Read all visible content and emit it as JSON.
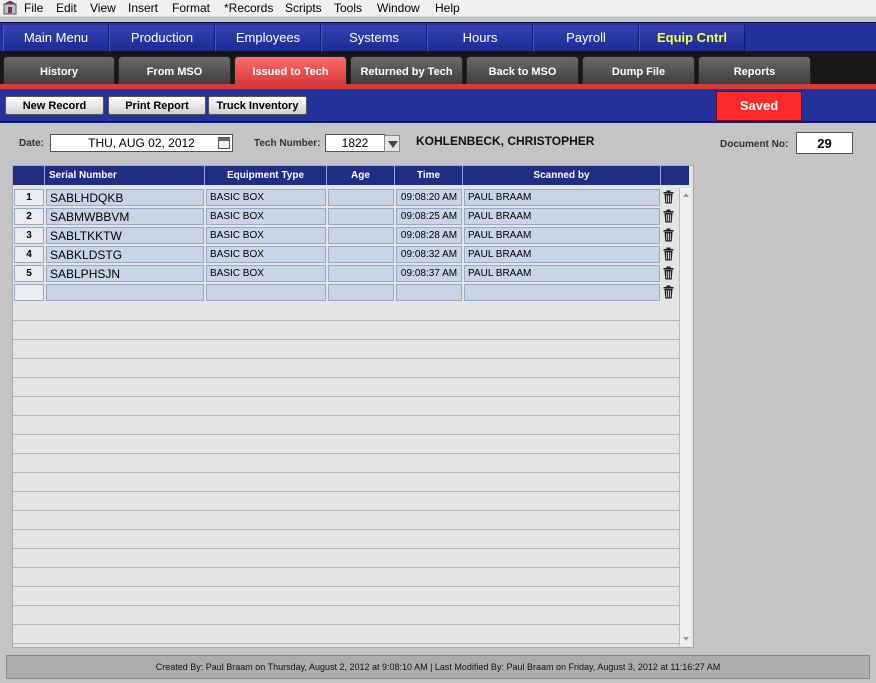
{
  "menubar": {
    "items": [
      "File",
      "Edit",
      "View",
      "Insert",
      "Format",
      "*Records",
      "Scripts",
      "Tools",
      "Window",
      "Help"
    ]
  },
  "mainnav": {
    "items": [
      "Main Menu",
      "Production",
      "Employees",
      "Systems",
      "Hours",
      "Payroll",
      "Equip Cntrl"
    ],
    "active": "Equip Cntrl"
  },
  "subtabs": {
    "items": [
      "History",
      "From MSO",
      "Issued to Tech",
      "Returned by Tech",
      "Back to MSO",
      "Dump File",
      "Reports"
    ],
    "active": "Issued to Tech"
  },
  "actions": {
    "new_record": "New Record",
    "print_report": "Print Report",
    "truck_inventory": "Truck Inventory",
    "status": "Saved"
  },
  "header": {
    "date_label": "Date:",
    "date_value": "THU, AUG 02, 2012",
    "tech_label": "Tech Number:",
    "tech_value": "1822",
    "tech_name": "KOHLENBECK, CHRISTOPHER",
    "doc_label": "Document No:",
    "doc_value": "29"
  },
  "grid": {
    "columns": [
      "Serial Number",
      "Equipment Type",
      "Age",
      "Time",
      "Scanned by"
    ],
    "rows": [
      {
        "n": "1",
        "serial": "SABLHDQKB",
        "type": "BASIC BOX",
        "age": "",
        "time": "09:08:20 AM",
        "by": "PAUL BRAAM"
      },
      {
        "n": "2",
        "serial": "SABMWBBVM",
        "type": "BASIC BOX",
        "age": "",
        "time": "09:08:25 AM",
        "by": "PAUL BRAAM"
      },
      {
        "n": "3",
        "serial": "SABLTKKTW",
        "type": "BASIC BOX",
        "age": "",
        "time": "09:08:28 AM",
        "by": "PAUL BRAAM"
      },
      {
        "n": "4",
        "serial": "SABKLDSTG",
        "type": "BASIC BOX",
        "age": "",
        "time": "09:08:32 AM",
        "by": "PAUL BRAAM"
      },
      {
        "n": "5",
        "serial": "SABLPHSJN",
        "type": "BASIC BOX",
        "age": "",
        "time": "09:08:37 AM",
        "by": "PAUL BRAAM"
      },
      {
        "n": "",
        "serial": "",
        "type": "",
        "age": "",
        "time": "",
        "by": ""
      }
    ]
  },
  "footer": {
    "text": "Created By: Paul Braam on Thursday, August 2, 2012 at 9:08:10 AM  |  Last Modified By: Paul Braam on Friday, August 3, 2012 at 11:16:27 AM"
  }
}
